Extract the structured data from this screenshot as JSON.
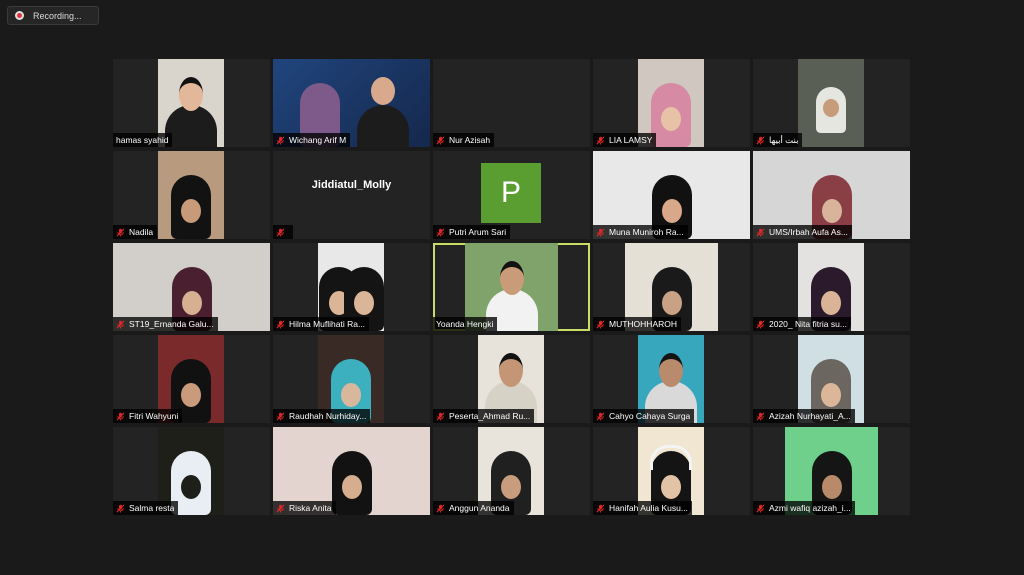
{
  "recording": {
    "label": "Recording..."
  },
  "participants": [
    {
      "name": "hamas syahid",
      "muted": false,
      "video": "man-cap"
    },
    {
      "name": "Wichang Arif M",
      "muted": true,
      "video": "poster"
    },
    {
      "name": "Nur Azisah",
      "muted": true,
      "video": "none"
    },
    {
      "name": "LIA LAMSY",
      "muted": true,
      "video": "hijab-pink"
    },
    {
      "name": "بنت أبيها",
      "muted": true,
      "video": "portrait-white"
    },
    {
      "name": "Nadila",
      "muted": true,
      "video": "hijab-black"
    },
    {
      "name": "Jiddiatul_Molly",
      "muted": true,
      "video": "name-only"
    },
    {
      "name": "Putri Arum Sari",
      "muted": true,
      "video": "avatar",
      "avatar_letter": "P"
    },
    {
      "name": "Muna Muniroh Ra...",
      "muted": true,
      "video": "hijab-glasses"
    },
    {
      "name": "UMS/Irbah Aufa As...",
      "muted": true,
      "video": "hijab-room"
    },
    {
      "name": "ST19_Ernanda Galu...",
      "muted": true,
      "video": "hijab-maroon"
    },
    {
      "name": "Hilma Muflihati Ra...",
      "muted": true,
      "video": "two-girls"
    },
    {
      "name": "Yoanda Hengki",
      "muted": false,
      "video": "man-outdoor",
      "active": true
    },
    {
      "name": "MUTHOHHAROH",
      "muted": true,
      "video": "hijab-dark"
    },
    {
      "name": "2020_ Nita fitria su...",
      "muted": true,
      "video": "hijab-plain"
    },
    {
      "name": "Fitri Wahyuni",
      "muted": true,
      "video": "hijab-door"
    },
    {
      "name": "Raudhah Nurhiday...",
      "muted": true,
      "video": "hijab-teal"
    },
    {
      "name": "Peserta_Ahmad Ru...",
      "muted": true,
      "video": "man-plain"
    },
    {
      "name": "Cahyo Cahaya Surga",
      "muted": true,
      "video": "man-teal"
    },
    {
      "name": "Azizah Nurhayati_A...",
      "muted": true,
      "video": "hijab-grey"
    },
    {
      "name": "Salma resta",
      "muted": true,
      "video": "dark-room"
    },
    {
      "name": "Riska Anita",
      "muted": true,
      "video": "hijab-close"
    },
    {
      "name": "Anggun Ananda",
      "muted": true,
      "video": "hijab-light"
    },
    {
      "name": "Hanifah Aulia Kusu...",
      "muted": true,
      "video": "hijab-headphones"
    },
    {
      "name": "Azmi wafiq azizah_i...",
      "muted": true,
      "video": "hijab-green"
    }
  ],
  "colors": {
    "background": "#1a1a1a",
    "tile": "#232323",
    "active_border": "#c8dd66",
    "mute_red": "#e02828",
    "avatar_green": "#5a9e32"
  }
}
